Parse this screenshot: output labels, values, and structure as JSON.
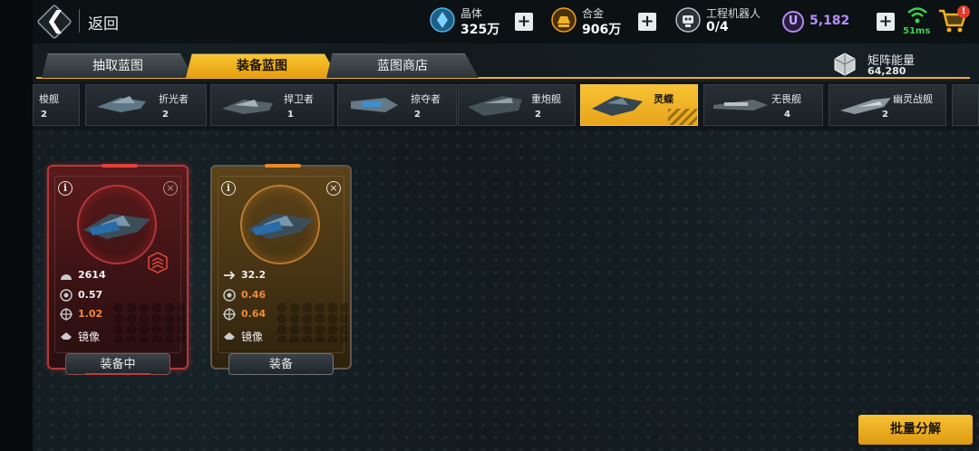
{
  "header": {
    "back_label": "返回",
    "resources": [
      {
        "name": "crystal",
        "label": "晶体",
        "value": "325万",
        "icon": "crystal-icon",
        "color": "#4fb3ea"
      },
      {
        "name": "alloy",
        "label": "合金",
        "value": "906万",
        "icon": "alloy-icon",
        "color": "#f0a020"
      },
      {
        "name": "robot",
        "label": "工程机器人",
        "value": "0/4",
        "icon": "robot-icon",
        "color": "#d8dcdd"
      }
    ],
    "premium_value": "5,182",
    "premium_color": "#b98cff",
    "ping": "51ms",
    "cart_badge": "!"
  },
  "tabs": [
    {
      "label": "抽取蓝图",
      "active": false
    },
    {
      "label": "装备蓝图",
      "active": true
    },
    {
      "label": "蓝图商店",
      "active": false
    }
  ],
  "matrix_energy": {
    "label": "矩阵能量",
    "value": "64,280"
  },
  "ships": [
    {
      "name": "梭舰",
      "count": "2"
    },
    {
      "name": "折光者",
      "count": "2"
    },
    {
      "name": "捍卫者",
      "count": "1"
    },
    {
      "name": "掠夺者",
      "count": "2"
    },
    {
      "name": "重炮舰",
      "count": "2"
    },
    {
      "name": "灵蝶",
      "count": "",
      "active": true
    },
    {
      "name": "无畏舰",
      "count": "4"
    },
    {
      "name": "幽灵战舰",
      "count": "2"
    }
  ],
  "blueprints": [
    {
      "theme": "red",
      "stats": [
        {
          "icon": "armor-icon",
          "value": "2614"
        },
        {
          "icon": "reload-icon",
          "value": "0.57"
        },
        {
          "icon": "accuracy-icon",
          "value": "1.02",
          "warn": true
        },
        {
          "icon": "mirror-icon",
          "value": "镜像"
        }
      ],
      "button": "装备中",
      "equipped": true
    },
    {
      "theme": "gold",
      "stats": [
        {
          "icon": "speed-icon",
          "value": "32.2"
        },
        {
          "icon": "reload-icon",
          "value": "0.46",
          "warn": true
        },
        {
          "icon": "accuracy-icon",
          "value": "0.64",
          "warn": true
        },
        {
          "icon": "mirror-icon",
          "value": "镜像"
        }
      ],
      "button": "装备",
      "equipped": false
    }
  ],
  "batch_button": "批量分解",
  "colors": {
    "accent": "#f2b01e",
    "warn": "#f08a3a",
    "equipped_glow": "#c23a3a"
  }
}
